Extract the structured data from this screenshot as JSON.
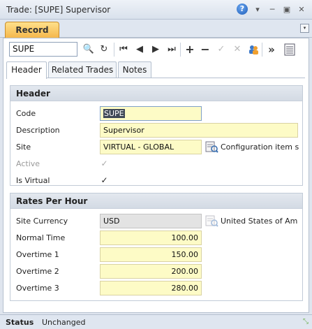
{
  "window": {
    "title": "Trade: [SUPE] Supervisor",
    "help_glyph": "?",
    "dropdown_glyph": "▾",
    "minimize_glyph": "─",
    "restore_glyph": "▣",
    "close_glyph": "✕"
  },
  "tabs": {
    "record": "Record",
    "menu_glyph": "▾"
  },
  "toolbar": {
    "search_value": "SUPE",
    "icons": [
      "search-icon",
      "refresh-icon",
      "first-record-icon",
      "previous-record-icon",
      "next-record-icon",
      "last-record-icon",
      "add-icon",
      "remove-icon",
      "save-icon",
      "cancel-icon",
      "users-icon",
      "more-icon",
      "document-icon"
    ],
    "glyphs": {
      "search": "🔍",
      "refresh": "↻",
      "first": "⏮",
      "prev": "◀",
      "next": "▶",
      "last": "⏭",
      "add": "+",
      "remove": "−",
      "save": "✓",
      "cancel": "✕",
      "more": "»"
    }
  },
  "subtabs": [
    "Header",
    "Related Trades",
    "Notes"
  ],
  "header_section": {
    "title": "Header",
    "code_label": "Code",
    "code_value": "SUPE",
    "description_label": "Description",
    "description_value": "Supervisor",
    "site_label": "Site",
    "site_value": "VIRTUAL - GLOBAL",
    "site_aside": "Configuration item s",
    "active_label": "Active",
    "is_virtual_label": "Is Virtual",
    "check_glyph": "✓"
  },
  "rates_section": {
    "title": "Rates Per Hour",
    "currency_label": "Site Currency",
    "currency_value": "USD",
    "currency_aside": "United States of Am",
    "normal_label": "Normal Time",
    "normal_value": "100.00",
    "ot1_label": "Overtime 1",
    "ot1_value": "150.00",
    "ot2_label": "Overtime 2",
    "ot2_value": "200.00",
    "ot3_label": "Overtime 3",
    "ot3_value": "280.00"
  },
  "status": {
    "label": "Status",
    "value": "Unchanged",
    "resize_glyph": "⤡"
  },
  "colors": {
    "accent_tab": "#f4b64a",
    "field_bg": "#fdfbc6",
    "section_head": "#d3dae4"
  }
}
